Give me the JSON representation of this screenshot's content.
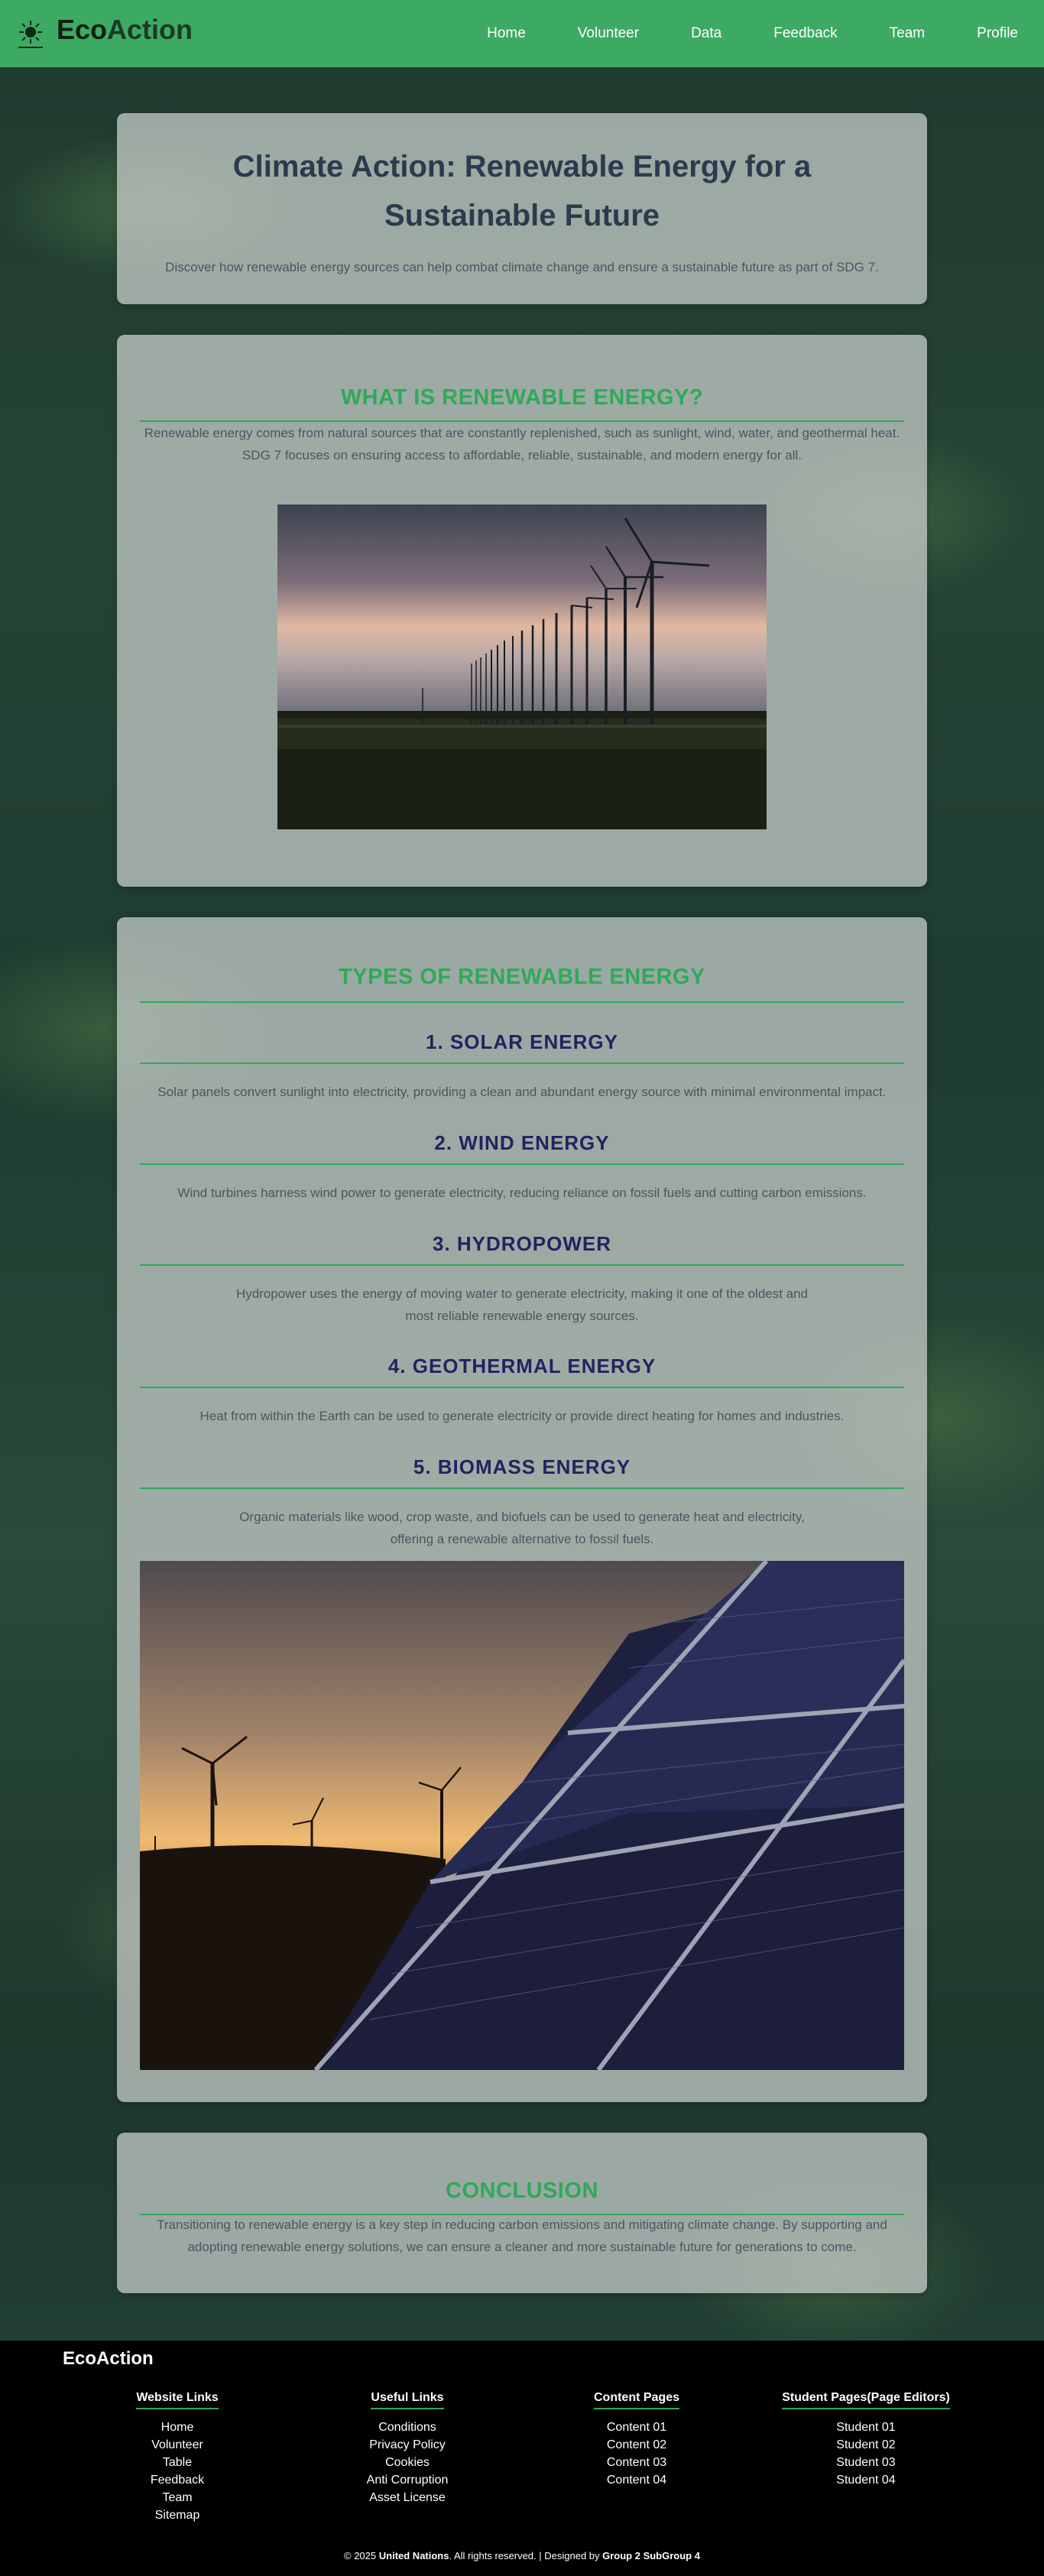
{
  "header": {
    "brand_prefix": "Eco",
    "brand_suffix": "Action",
    "nav": [
      "Home",
      "Volunteer",
      "Data",
      "Feedback",
      "Team",
      "Profile"
    ]
  },
  "hero": {
    "title": "Climate Action: Renewable Energy for a Sustainable Future",
    "subtitle": "Discover how renewable energy sources can help combat climate change and ensure a sustainable future as part of SDG 7."
  },
  "what": {
    "title": "WHAT IS RENEWABLE ENERGY?",
    "text": "Renewable energy comes from natural sources that are constantly replenished, such as sunlight, wind, water, and geothermal heat. SDG 7 focuses on ensuring access to affordable, reliable, sustainable, and modern energy for all."
  },
  "types": {
    "title": "TYPES OF RENEWABLE ENERGY",
    "items": [
      {
        "heading": "1. SOLAR ENERGY",
        "text": "Solar panels convert sunlight into electricity, providing a clean and abundant energy source with minimal environmental impact."
      },
      {
        "heading": "2. WIND ENERGY",
        "text": "Wind turbines harness wind power to generate electricity, reducing reliance on fossil fuels and cutting carbon emissions."
      },
      {
        "heading": "3. HYDROPOWER",
        "text": "Hydropower uses the energy of moving water to generate electricity, making it one of the oldest and most reliable renewable energy sources."
      },
      {
        "heading": "4. GEOTHERMAL ENERGY",
        "text": "Heat from within the Earth can be used to generate electricity or provide direct heating for homes and industries."
      },
      {
        "heading": "5. BIOMASS ENERGY",
        "text": "Organic materials like wood, crop waste, and biofuels can be used to generate heat and electricity, offering a renewable alternative to fossil fuels."
      }
    ]
  },
  "conclusion": {
    "title": "CONCLUSION",
    "text": "Transitioning to renewable energy is a key step in reducing carbon emissions and mitigating climate change. By supporting and adopting renewable energy solutions, we can ensure a cleaner and more sustainable future for generations to come."
  },
  "footer": {
    "brand": "EcoAction",
    "columns": [
      {
        "title": "Website Links",
        "links": [
          "Home",
          "Volunteer",
          "Table",
          "Feedback",
          "Team",
          "Sitemap"
        ]
      },
      {
        "title": "Useful Links",
        "links": [
          "Conditions",
          "Privacy Policy",
          "Cookies",
          "Anti Corruption",
          "Asset License"
        ]
      },
      {
        "title": "Content Pages",
        "links": [
          "Content 01",
          "Content 02",
          "Content 03",
          "Content 04"
        ]
      },
      {
        "title": "Student Pages(Page Editors)",
        "links": [
          "Student 01",
          "Student 02",
          "Student 03",
          "Student 04"
        ]
      }
    ],
    "copy_prefix": "© 2025 ",
    "copy_org": "United Nations",
    "copy_mid": ". All rights reserved. | Designed by ",
    "copy_group": "Group 2 SubGroup 4"
  },
  "colors": {
    "header_green": "#3daa63",
    "section_green": "#2eaa58",
    "subheading_navy": "#262160"
  }
}
